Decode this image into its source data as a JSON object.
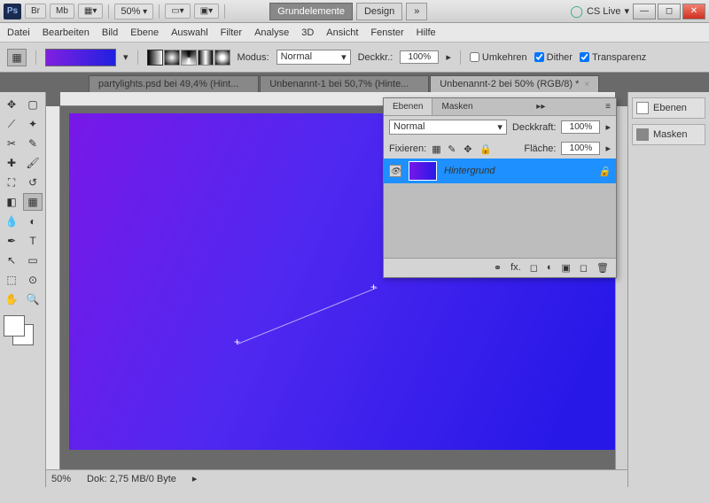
{
  "titlebar": {
    "logo": "Ps",
    "br": "Br",
    "mb": "Mb",
    "zoom": "50%",
    "workspaces": {
      "grund": "Grundelemente",
      "design": "Design",
      "more": "»"
    },
    "cslive": "CS Live"
  },
  "menu": [
    "Datei",
    "Bearbeiten",
    "Bild",
    "Ebene",
    "Auswahl",
    "Filter",
    "Analyse",
    "3D",
    "Ansicht",
    "Fenster",
    "Hilfe"
  ],
  "optbar": {
    "modus_lbl": "Modus:",
    "modus_val": "Normal",
    "deck_lbl": "Deckkr.:",
    "deck_val": "100%",
    "umkehren": "Umkehren",
    "dither": "Dither",
    "transparenz": "Transparenz"
  },
  "tabs": [
    {
      "label": "partylights.psd bei 49,4% (Hint...",
      "active": false
    },
    {
      "label": "Unbenannt-1 bei 50,7% (Hinte...",
      "active": false
    },
    {
      "label": "Unbenannt-2 bei 50% (RGB/8) *",
      "active": true
    }
  ],
  "layers_panel": {
    "tab1": "Ebenen",
    "tab2": "Masken",
    "blend": "Normal",
    "deckkraft_lbl": "Deckkraft:",
    "deckkraft_val": "100%",
    "fix_lbl": "Fixieren:",
    "flaeche_lbl": "Fläche:",
    "flaeche_val": "100%",
    "layer_name": "Hintergrund"
  },
  "rpanel": {
    "ebenen": "Ebenen",
    "masken": "Masken"
  },
  "status": {
    "zoom": "50%",
    "dok": "Dok: 2,75 MB/0 Byte"
  }
}
